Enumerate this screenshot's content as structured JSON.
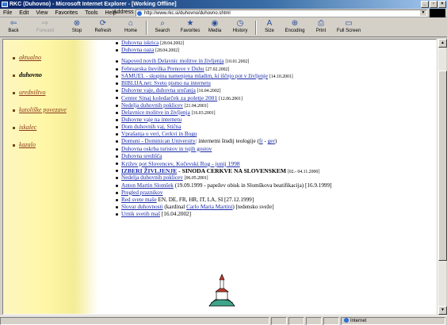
{
  "window": {
    "title": "RKC (Duhovno) - Microsoft Internet Explorer - [Working Offline]"
  },
  "menu": [
    "File",
    "Edit",
    "View",
    "Favorites",
    "Tools",
    "Help"
  ],
  "address": {
    "label": "Address",
    "url": "http://www.rkc.si/duhovno/duhovno.shtml"
  },
  "toolbar": {
    "back": "Back",
    "forward": "Forward",
    "stop": "Stop",
    "refresh": "Refresh",
    "home": "Home",
    "search": "Search",
    "favorites": "Favorites",
    "media": "Media",
    "history": "History",
    "size": "Size",
    "encoding": "Encoding",
    "print": "Print",
    "fullscreen": "Full Screen"
  },
  "sidebar": {
    "items": [
      {
        "label": "aktualno"
      },
      {
        "label": "duhovno"
      },
      {
        "label": "uredništvo"
      },
      {
        "label": "katoliške povezave"
      },
      {
        "label": "iskalec"
      },
      {
        "label": "kazalo"
      }
    ]
  },
  "links": [
    {
      "link": "Duhovna iskrica",
      "date": "[28.04.2002]"
    },
    {
      "link": "Duhovna oaza",
      "date": "[28.04.2002]"
    },
    {
      "link": "Napoved novih Delavnic molitve in življenja",
      "date": "[10.01.2002]"
    },
    {
      "link": "Februarska številka Prenove v Duhu",
      "date": "[27.02.2002]"
    },
    {
      "link": "SAMUEL - skupina namenjena mladim, ki iščejo pot v življenje",
      "date": "[14.10.2001]"
    },
    {
      "link": "BIBLIJA.net: Sveto pismo na internetu"
    },
    {
      "link": "Duhovne vaje, duhovna srečanja",
      "date": "[16.04.2002]"
    },
    {
      "link": "Center Sinaj koledarček za poletje 2001",
      "date": "[12.06.2001]"
    },
    {
      "link": "Nedelja duhovnih poklicev",
      "date": "[21.04.2001]"
    },
    {
      "link": "Delavnice molitve in življenja",
      "date": "[16.03.2001]"
    },
    {
      "link": "Duhovne vaje na internetu"
    },
    {
      "link": "Dom duhovnih vaj, Stična"
    },
    {
      "link": "Vprašanja o veri, Cerkvi in Bogu"
    },
    {
      "link": "Domuni - Dominican University",
      "text": ": internetni študij teologije (",
      "link2": "fr",
      "sep": " - ",
      "link3": "ger",
      "tail": ")"
    },
    {
      "link": "Duhovna oskrba turistov in tujih gostov"
    },
    {
      "link": "Duhovna središča"
    },
    {
      "link": "Križev pot Slovencev, Kočevski Rog - junij 1998"
    },
    {
      "link": "IZBERI ŽIVLJENJE",
      "text": " - SINODA CERKVE NA SLOVENSKEM",
      "date": "[02.- 04.11.2000]"
    },
    {
      "link": "Nedelja duhovnih poklicev",
      "date": "[06.05.2001]"
    },
    {
      "link": "Anton Martin Slomšek",
      "text": " (19.09.1999 - papežev obisk in Slomškova beatifikacija) [16.9.1999]"
    },
    {
      "link": "Pregled praznikov"
    },
    {
      "link": "Red svete maše",
      "text": " EN, DE, FR, HR, IT, LA, SI [27.12.1999]"
    },
    {
      "link": "Slovar duhovnosti",
      "text": " (kardinal ",
      "link2": "Carlo Maria Martini",
      "tail": ") [tedensko sveže]"
    },
    {
      "link": "Urnik svetih maš",
      "text": " [16.04.2002]"
    }
  ],
  "status": {
    "zone": "Internet"
  }
}
